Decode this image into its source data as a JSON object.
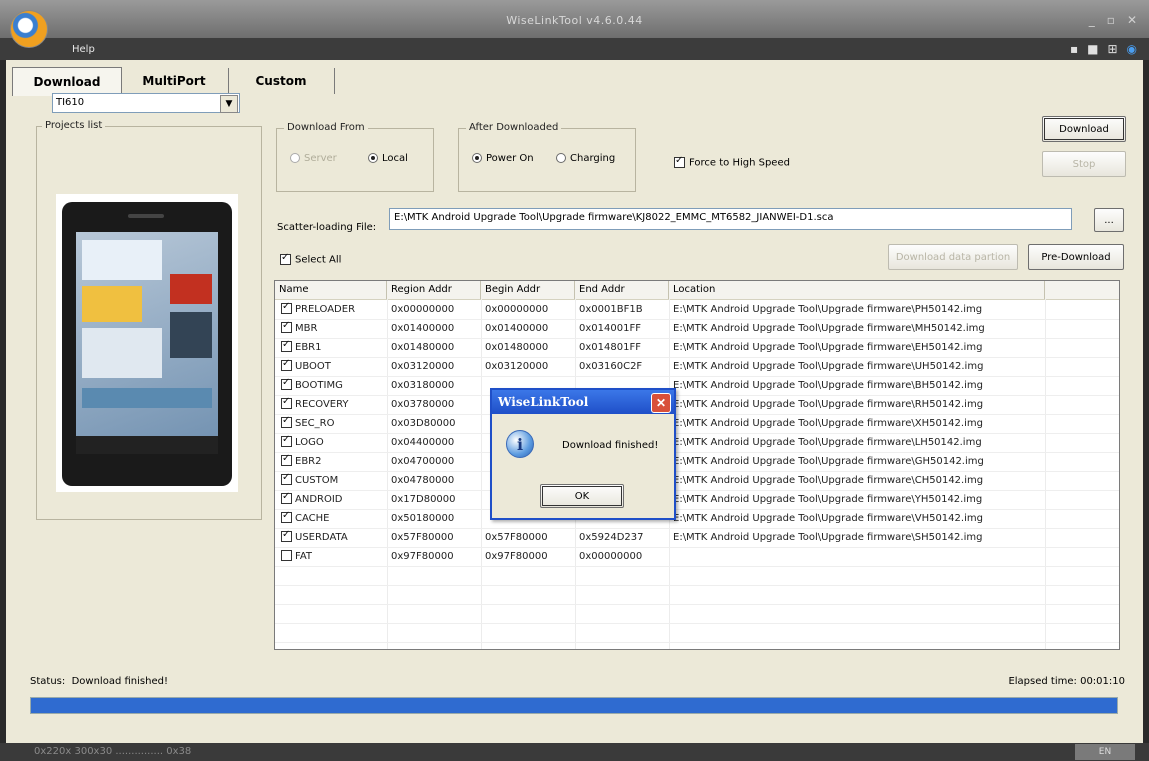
{
  "window": {
    "title": "WiseLinkTool v4.6.0.44"
  },
  "menu": {
    "help": "Help"
  },
  "tabs": [
    {
      "label": "Download",
      "active": true
    },
    {
      "label": "MultiPort",
      "active": false
    },
    {
      "label": "Custom",
      "active": false
    }
  ],
  "projects": {
    "label": "Projects list",
    "selected": "TI610"
  },
  "download_from": {
    "label": "Download From",
    "server": "Server",
    "local": "Local",
    "selected": "Local"
  },
  "after_downloaded": {
    "label": "After Downloaded",
    "power_on": "Power On",
    "charging": "Charging",
    "selected": "Power On"
  },
  "force_high_speed": {
    "label": "Force to High Speed",
    "checked": true
  },
  "buttons": {
    "download": "Download",
    "stop": "Stop",
    "browse": "...",
    "download_data_partition": "Download data partion",
    "pre_download": "Pre-Download"
  },
  "scatter": {
    "label": "Scatter-loading File:",
    "value": "E:\\MTK Android Upgrade Tool\\Upgrade firmware\\KJ8022_EMMC_MT6582_JIANWEI-D1.sca"
  },
  "select_all": {
    "label": "Select All",
    "checked": true
  },
  "table": {
    "headers": [
      "Name",
      "Region Addr",
      "Begin Addr",
      "End Addr",
      "Location"
    ],
    "rows": [
      {
        "checked": true,
        "name": "PRELOADER",
        "region": "0x00000000",
        "begin": "0x00000000",
        "end": "0x0001BF1B",
        "location": "E:\\MTK Android Upgrade Tool\\Upgrade firmware\\PH50142.img"
      },
      {
        "checked": true,
        "name": "MBR",
        "region": "0x01400000",
        "begin": "0x01400000",
        "end": "0x014001FF",
        "location": "E:\\MTK Android Upgrade Tool\\Upgrade firmware\\MH50142.img"
      },
      {
        "checked": true,
        "name": "EBR1",
        "region": "0x01480000",
        "begin": "0x01480000",
        "end": "0x014801FF",
        "location": "E:\\MTK Android Upgrade Tool\\Upgrade firmware\\EH50142.img"
      },
      {
        "checked": true,
        "name": "UBOOT",
        "region": "0x03120000",
        "begin": "0x03120000",
        "end": "0x03160C2F",
        "location": "E:\\MTK Android Upgrade Tool\\Upgrade firmware\\UH50142.img"
      },
      {
        "checked": true,
        "name": "BOOTIMG",
        "region": "0x03180000",
        "begin": "",
        "end": "",
        "location": "E:\\MTK Android Upgrade Tool\\Upgrade firmware\\BH50142.img"
      },
      {
        "checked": true,
        "name": "RECOVERY",
        "region": "0x03780000",
        "begin": "",
        "end": "",
        "location": "E:\\MTK Android Upgrade Tool\\Upgrade firmware\\RH50142.img"
      },
      {
        "checked": true,
        "name": "SEC_RO",
        "region": "0x03D80000",
        "begin": "",
        "end": "",
        "location": "E:\\MTK Android Upgrade Tool\\Upgrade firmware\\XH50142.img"
      },
      {
        "checked": true,
        "name": "LOGO",
        "region": "0x04400000",
        "begin": "",
        "end": "",
        "location": "E:\\MTK Android Upgrade Tool\\Upgrade firmware\\LH50142.img"
      },
      {
        "checked": true,
        "name": "EBR2",
        "region": "0x04700000",
        "begin": "",
        "end": "",
        "location": "E:\\MTK Android Upgrade Tool\\Upgrade firmware\\GH50142.img"
      },
      {
        "checked": true,
        "name": "CUSTOM",
        "region": "0x04780000",
        "begin": "",
        "end": "",
        "location": "E:\\MTK Android Upgrade Tool\\Upgrade firmware\\CH50142.img"
      },
      {
        "checked": true,
        "name": "ANDROID",
        "region": "0x17D80000",
        "begin": "",
        "end": "",
        "location": "E:\\MTK Android Upgrade Tool\\Upgrade firmware\\YH50142.img"
      },
      {
        "checked": true,
        "name": "CACHE",
        "region": "0x50180000",
        "begin": "",
        "end": "",
        "location": "E:\\MTK Android Upgrade Tool\\Upgrade firmware\\VH50142.img"
      },
      {
        "checked": true,
        "name": "USERDATA",
        "region": "0x57F80000",
        "begin": "0x57F80000",
        "end": "0x5924D237",
        "location": "E:\\MTK Android Upgrade Tool\\Upgrade firmware\\SH50142.img"
      },
      {
        "checked": false,
        "name": "FAT",
        "region": "0x97F80000",
        "begin": "0x97F80000",
        "end": "0x00000000",
        "location": ""
      }
    ]
  },
  "status": {
    "label": "Status:",
    "value": "Download finished!"
  },
  "elapsed": {
    "label": "Elapsed time:",
    "value": "00:01:10"
  },
  "progress": {
    "percent": 100,
    "color": "#2f6bd0"
  },
  "dialog": {
    "title": "WiseLinkTool",
    "message": "Download finished!",
    "ok": "OK"
  },
  "taskbar": {
    "left": "0x220x 300x30 ............... 0x38",
    "right": "EN"
  }
}
